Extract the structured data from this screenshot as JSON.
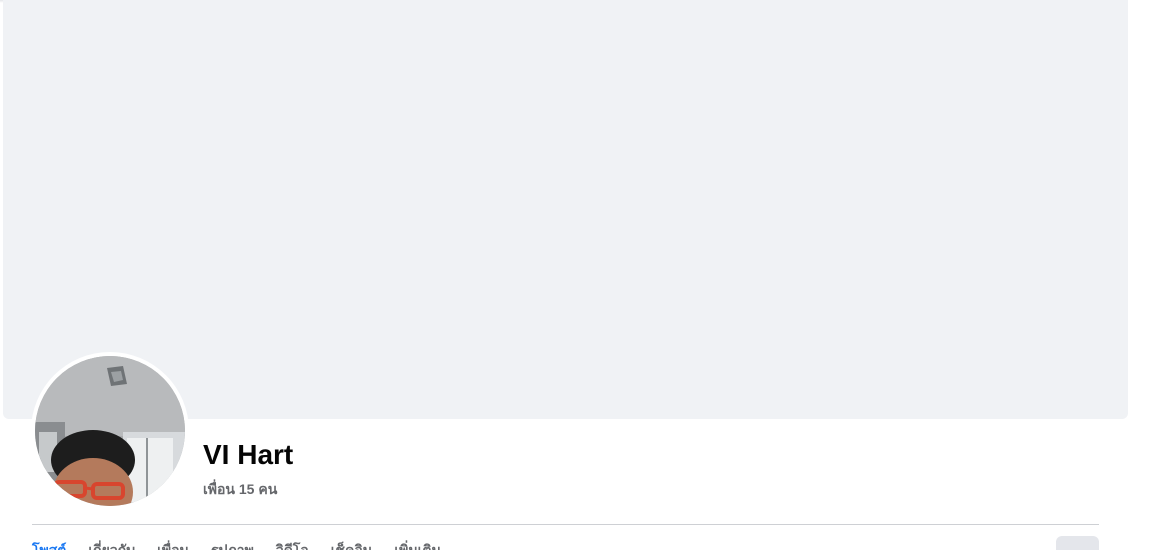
{
  "profile": {
    "name": "VI Hart",
    "friends": "เพื่อน 15 คน",
    "avatar_icon": "profile-photo"
  },
  "tabs": [
    {
      "label": "โพสต์",
      "active": true
    },
    {
      "label": "เกี่ยวกับ",
      "active": false
    },
    {
      "label": "เพื่อน",
      "active": false
    },
    {
      "label": "รูปภาพ",
      "active": false
    },
    {
      "label": "วิดีโอ",
      "active": false
    },
    {
      "label": "เช็คอิน",
      "active": false
    },
    {
      "label": "เพิ่มเติม",
      "active": false
    }
  ],
  "colors": {
    "cover": "#f0f2f5",
    "accent": "#1877f2",
    "secondary_text": "#65676b"
  }
}
